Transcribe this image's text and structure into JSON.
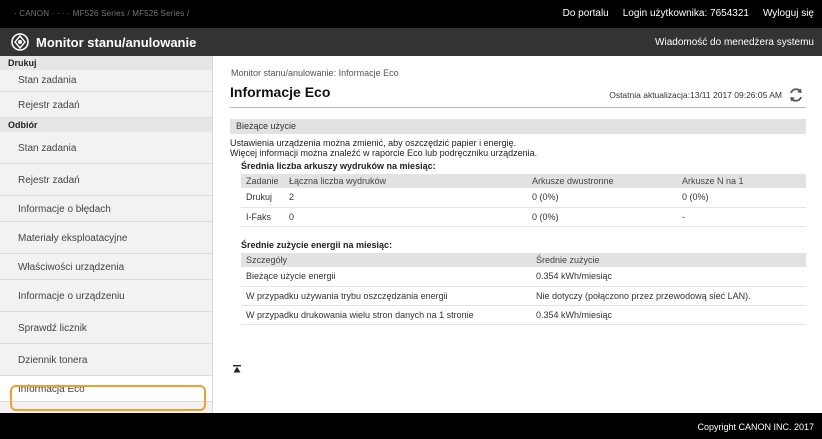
{
  "topbar": {
    "device": "· CANON · · ·  · MF526 Series / MF526 Series /",
    "portal_link": "Do portalu",
    "login_label": "Login użytkownika:",
    "login_user": "7654321",
    "logout_link": "Wyloguj się"
  },
  "titlebar": {
    "title": "Monitor stanu/anulowanie",
    "message": "Wiadomość do menedżera systemu"
  },
  "sidebar": {
    "group1": "Drukuj",
    "g1_items": [
      "Stan zadania",
      "Rejestr zadań"
    ],
    "group2": "Odbiór",
    "g2_items": [
      "Stan zadania",
      "Rejestr zadań",
      "Informacje o błędach",
      "Materiały eksploatacyjne",
      "Właściwości urządzenia",
      "Informacje o urządzeniu",
      "Sprawdź licznik",
      "Dziennik tonera",
      "Informacja Eco"
    ]
  },
  "main": {
    "breadcrumb": "Monitor stanu/anulowanie: Informacje Eco",
    "title": "Informacje Eco",
    "last_update": "Ostatnia aktualizacja:13/11 2017 09:26:05 AM",
    "section_title": "Bieżące użycie",
    "desc_line1": "Ustawienia urządzenia można zmienić, aby oszczędzić papier i energię.",
    "desc_line2": "Więcej informacji można znaleźć w raporcie Eco lub podręczniku urządzenia.",
    "sheets_heading": "Średnia liczba arkuszy wydruków na miesiąc:",
    "sheets_table": {
      "headers": [
        "Zadanie",
        "Łączna liczba wydruków",
        "Arkusze dwustronne",
        "Arkusze N na 1"
      ],
      "rows": [
        [
          "Drukuj",
          "2",
          "0 (0%)",
          "0 (0%)"
        ],
        [
          "I-Faks",
          "0",
          "0 (0%)",
          "-"
        ]
      ]
    },
    "energy_heading": "Średnie zużycie energii na miesiąc:",
    "energy_table": {
      "headers": [
        "Szczegóły",
        "Średnie zużycie"
      ],
      "rows": [
        [
          "Bieżące użycie energii",
          "0.354 kWh/miesiąc"
        ],
        [
          "W przypadku używania trybu oszczędzania energii",
          "Nie dotyczy (połączono przez przewodową sieć LAN)."
        ],
        [
          "W przypadku drukowania wielu stron danych na 1 stronie",
          "0.354 kWh/miesiąc"
        ]
      ]
    }
  },
  "footer": {
    "copyright": "Copyright CANON INC. 2017"
  },
  "colors": {
    "highlight": "#f0a030",
    "topbar": "#000000",
    "titlebar": "#333333"
  }
}
